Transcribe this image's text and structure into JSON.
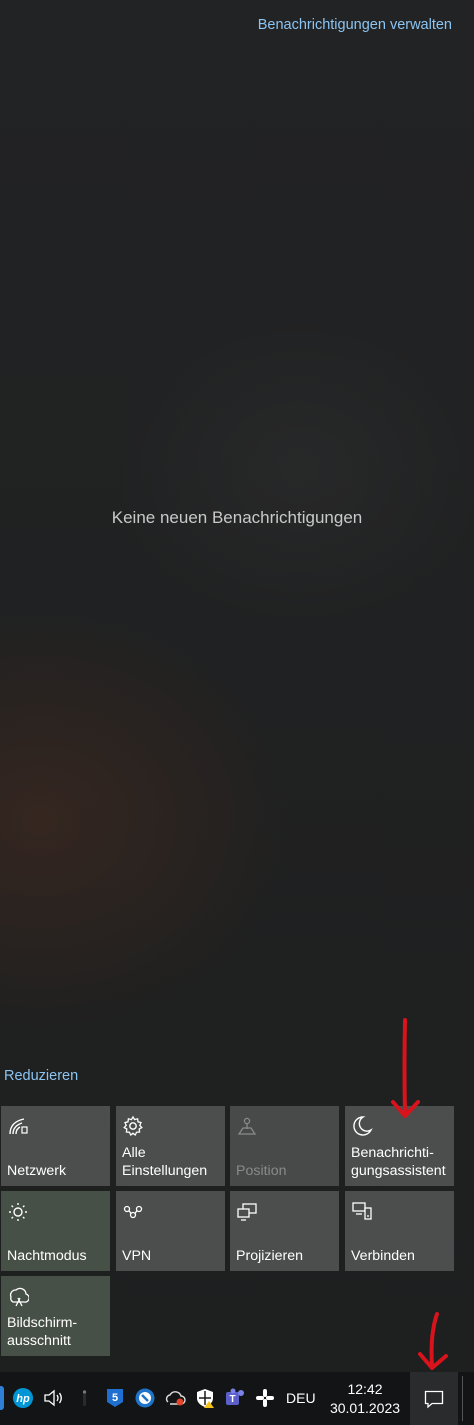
{
  "action_center": {
    "manage_link": "Benachrichtigungen verwalten",
    "empty_message": "Keine neuen Benachrichtigungen",
    "collapse_link": "Reduzieren"
  },
  "quick_actions": [
    {
      "label": "Netzwerk",
      "icon": "network-icon",
      "state": "enabled"
    },
    {
      "label": "Alle\nEinstellungen",
      "icon": "gear-icon",
      "state": "enabled"
    },
    {
      "label": "Position",
      "icon": "location-icon",
      "state": "disabled"
    },
    {
      "label": "Benachrichti-\ngungsassistent",
      "icon": "moon-icon",
      "state": "enabled"
    },
    {
      "label": "Nachtmodus",
      "icon": "sun-icon",
      "state": "enabled"
    },
    {
      "label": "VPN",
      "icon": "vpn-icon",
      "state": "enabled"
    },
    {
      "label": "Projizieren",
      "icon": "project-icon",
      "state": "enabled"
    },
    {
      "label": "Verbinden",
      "icon": "connect-icon",
      "state": "enabled"
    },
    {
      "label": "Bildschirm-\nausschnitt",
      "icon": "snip-icon",
      "state": "enabled"
    }
  ],
  "taskbar": {
    "tray_icons": [
      "hp-icon",
      "volume-icon",
      "slim-app-icon",
      "s5-app-icon",
      "globe-app-icon",
      "cloud-sync-icon",
      "security-shield-icon",
      "teams-icon",
      "slack-icon"
    ],
    "language": "DEU",
    "time": "12:42",
    "date": "30.01.2023",
    "notification_button_icon": "action-center-icon"
  },
  "annotations": {
    "arrow_color": "#d8131b"
  },
  "colors": {
    "link": "#8cc4f2",
    "tile": "#4c4d4d",
    "panel_bg": "#1f2020",
    "taskbar_bg": "#131415"
  }
}
